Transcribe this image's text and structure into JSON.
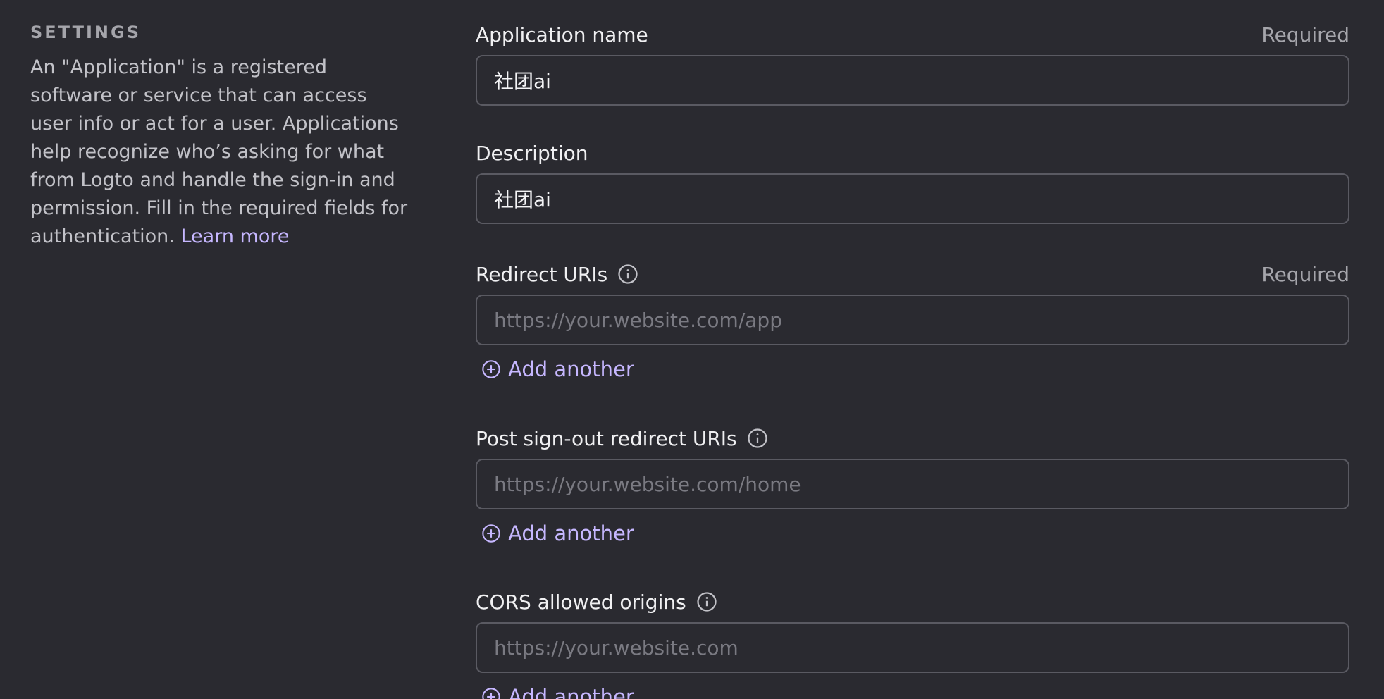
{
  "settings": {
    "title": "SETTINGS",
    "description": "An \"Application\" is a registered software or service that can access user info or act for a user. Applications help recognize who’s asking for what from Logto and handle the sign-in and permission. Fill in the required fields for authentication.",
    "learn_more": "Learn more"
  },
  "fields": {
    "app_name": {
      "label": "Application name",
      "required": "Required",
      "value": "社团ai"
    },
    "description": {
      "label": "Description",
      "value": "社团ai"
    },
    "redirect_uris": {
      "label": "Redirect URIs",
      "required": "Required",
      "placeholder": "https://your.website.com/app",
      "add_label": "Add another"
    },
    "post_signout": {
      "label": "Post sign-out redirect URIs",
      "placeholder": "https://your.website.com/home",
      "add_label": "Add another"
    },
    "cors": {
      "label": "CORS allowed origins",
      "placeholder": "https://your.website.com",
      "add_label": "Add another"
    }
  },
  "colors": {
    "background": "#2a2a30",
    "accent": "#c6b7ff",
    "border": "#5a5a62"
  },
  "icons": {
    "info": "info-circle-icon",
    "add": "plus-circle-icon"
  }
}
